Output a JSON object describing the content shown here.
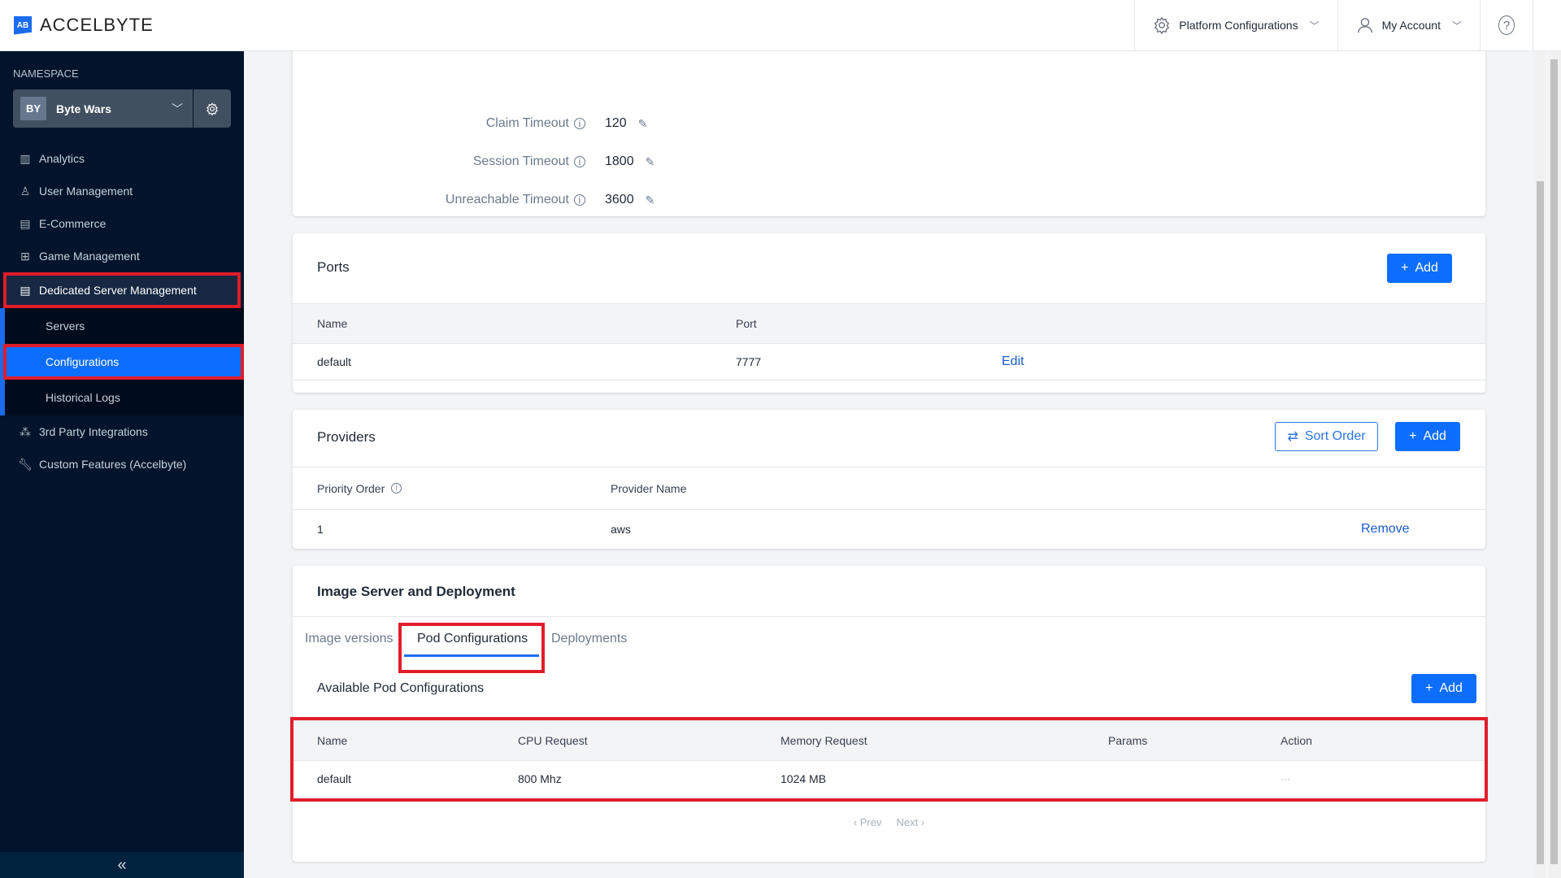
{
  "header": {
    "logo_mark": "AB",
    "logo_text": "ACCELBYTE",
    "platform_config": "Platform Configurations",
    "my_account": "My Account",
    "help": "?"
  },
  "sidebar": {
    "namespace_label": "NAMESPACE",
    "namespace_badge": "BY",
    "namespace_name": "Byte Wars",
    "items": [
      {
        "label": "Analytics",
        "icon": "bar-chart-icon"
      },
      {
        "label": "User Management",
        "icon": "user-icon"
      },
      {
        "label": "E-Commerce",
        "icon": "store-icon"
      },
      {
        "label": "Game Management",
        "icon": "hierarchy-icon"
      },
      {
        "label": "Dedicated Server Management",
        "icon": "server-icon"
      }
    ],
    "sub_items": [
      {
        "label": "Servers"
      },
      {
        "label": "Configurations"
      },
      {
        "label": "Historical Logs"
      }
    ],
    "items_after": [
      {
        "label": "3rd Party Integrations",
        "icon": "integration-icon"
      },
      {
        "label": "Custom Features (Accelbyte)",
        "icon": "wrench-icon"
      }
    ],
    "collapse": "«"
  },
  "timeouts": [
    {
      "label": "Claim Timeout",
      "value": "120"
    },
    {
      "label": "Session Timeout",
      "value": "1800"
    },
    {
      "label": "Unreachable Timeout",
      "value": "3600"
    }
  ],
  "ports": {
    "title": "Ports",
    "add_label": "Add",
    "columns": [
      "Name",
      "Port"
    ],
    "rows": [
      {
        "name": "default",
        "port": "7777",
        "action": "Edit"
      }
    ]
  },
  "providers": {
    "title": "Providers",
    "sort_label": "Sort Order",
    "add_label": "Add",
    "columns": [
      "Priority Order",
      "Provider Name"
    ],
    "rows": [
      {
        "priority": "1",
        "provider": "aws",
        "action": "Remove"
      }
    ]
  },
  "image_server": {
    "title": "Image Server and Deployment",
    "tabs": [
      "Image versions",
      "Pod Configurations",
      "Deployments"
    ],
    "active_tab": "Pod Configurations",
    "section_title": "Available Pod Configurations",
    "add_label": "Add",
    "columns": [
      "Name",
      "CPU Request",
      "Memory Request",
      "Params",
      "Action"
    ],
    "rows": [
      {
        "name": "default",
        "cpu": "800 Mhz",
        "memory": "1024 MB",
        "params": "",
        "action": "···"
      }
    ],
    "prev": "‹ Prev",
    "next": "Next ›"
  }
}
